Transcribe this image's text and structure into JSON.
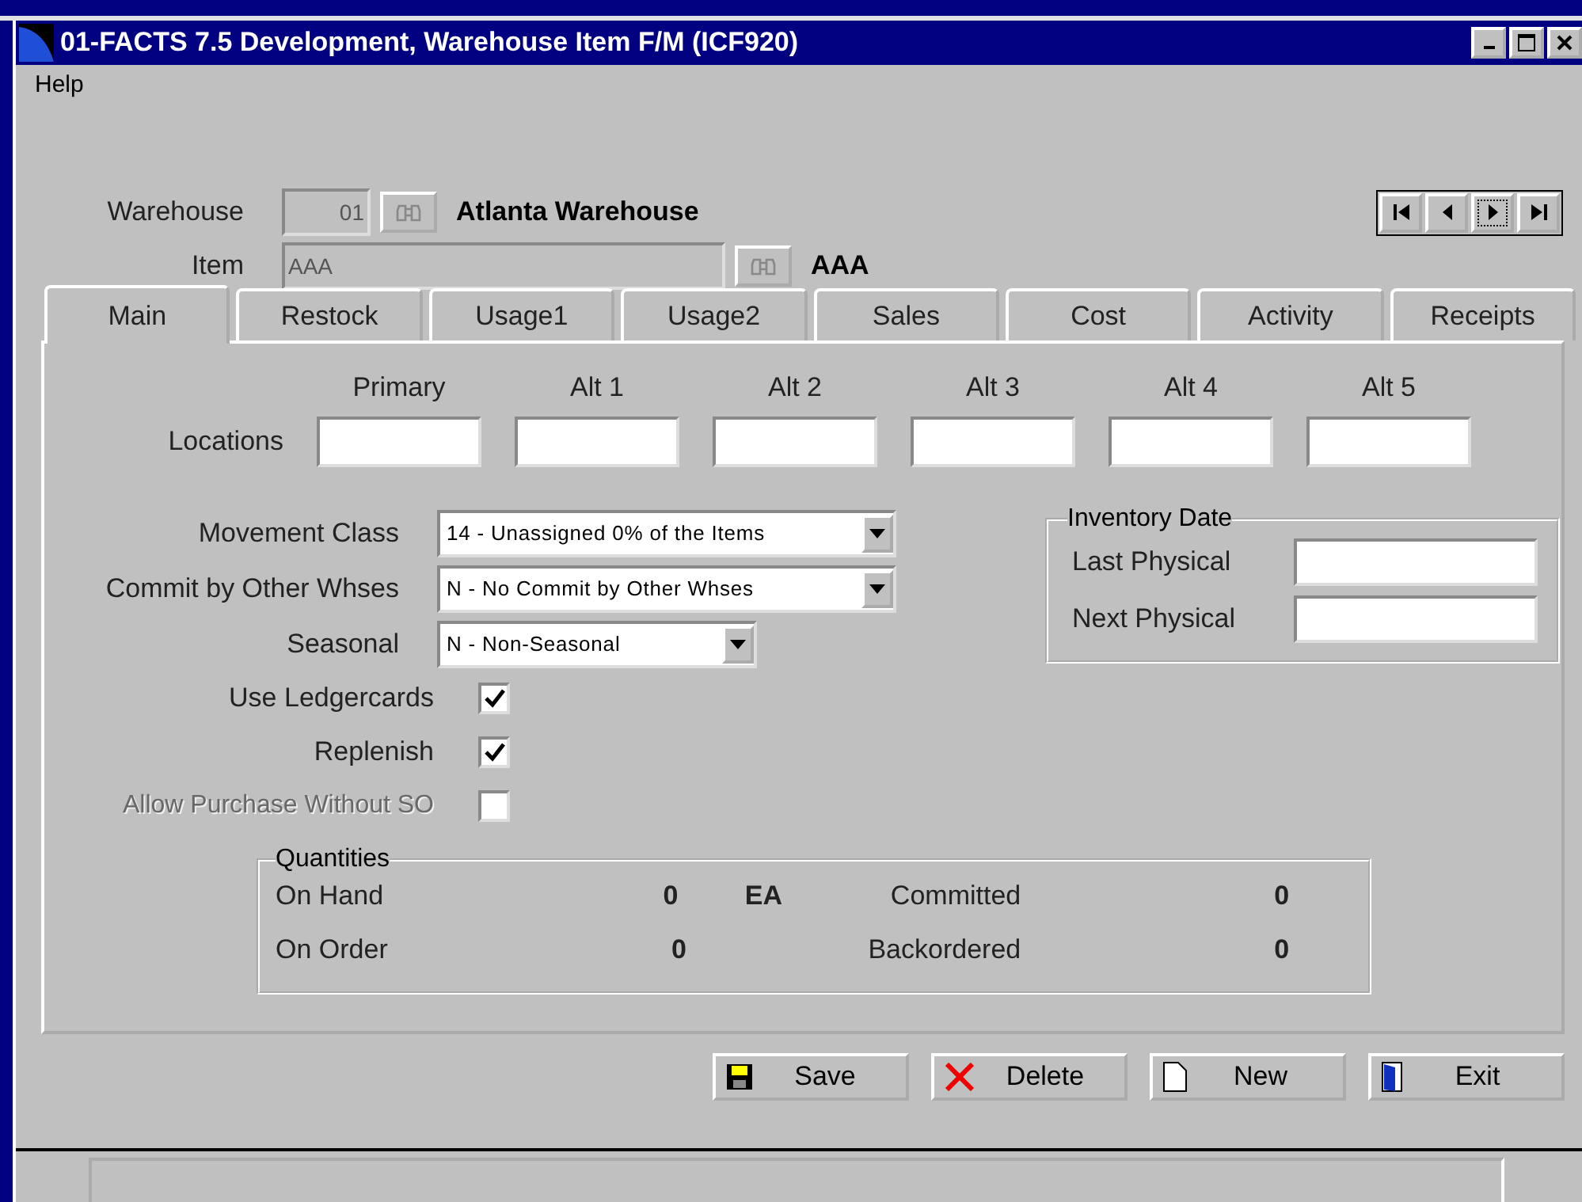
{
  "window": {
    "title": "01-FACTS 7.5 Development, Warehouse Item F/M (ICF920)"
  },
  "menu": [
    "Help"
  ],
  "header": {
    "warehouse": {
      "label": "Warehouse",
      "value": "01",
      "name": "Atlanta Warehouse"
    },
    "item": {
      "label": "Item",
      "value": "AAA",
      "name": "AAA"
    }
  },
  "tabs": [
    {
      "label": "Main",
      "selected": true
    },
    {
      "label": "Restock",
      "selected": false
    },
    {
      "label": "Usage1",
      "selected": false
    },
    {
      "label": "Usage2",
      "selected": false
    },
    {
      "label": "Sales",
      "selected": false
    },
    {
      "label": "Cost",
      "selected": false
    },
    {
      "label": "Activity",
      "selected": false
    },
    {
      "label": "Receipts",
      "selected": false
    }
  ],
  "locations": {
    "label": "Locations",
    "columns": [
      "Primary",
      "Alt 1",
      "Alt 2",
      "Alt 3",
      "Alt 4",
      "Alt 5"
    ]
  },
  "dropdowns": [
    {
      "label": "Movement Class",
      "value": "14 - Unassigned 0% of the Items",
      "kind": "wide"
    },
    {
      "label": "Commit by Other Whses",
      "value": "N - No Commit by Other Whses",
      "kind": "wide"
    },
    {
      "label": "Seasonal",
      "value": "N - Non-Seasonal",
      "kind": "narrow"
    }
  ],
  "checkboxes": [
    {
      "label": "Use Ledgercards",
      "checked": true,
      "disabled": false
    },
    {
      "label": "Replenish",
      "checked": true,
      "disabled": false
    },
    {
      "label": "Allow Purchase Without SO",
      "checked": false,
      "disabled": true
    }
  ],
  "inventory_date": {
    "title": "Inventory Date",
    "fields": [
      "Last Physical",
      "Next Physical"
    ]
  },
  "quantities": {
    "title": "Quantities",
    "items": [
      {
        "label": "On Hand",
        "value": "0",
        "unit": "EA"
      },
      {
        "label": "Committed",
        "value": "0"
      },
      {
        "label": "On Order",
        "value": "0"
      },
      {
        "label": "Backordered",
        "value": "0"
      }
    ]
  },
  "buttons": [
    {
      "label": "Save",
      "kind": "save"
    },
    {
      "label": "Delete",
      "kind": "delete"
    },
    {
      "label": "New",
      "kind": "new"
    },
    {
      "label": "Exit",
      "kind": "exit"
    }
  ]
}
